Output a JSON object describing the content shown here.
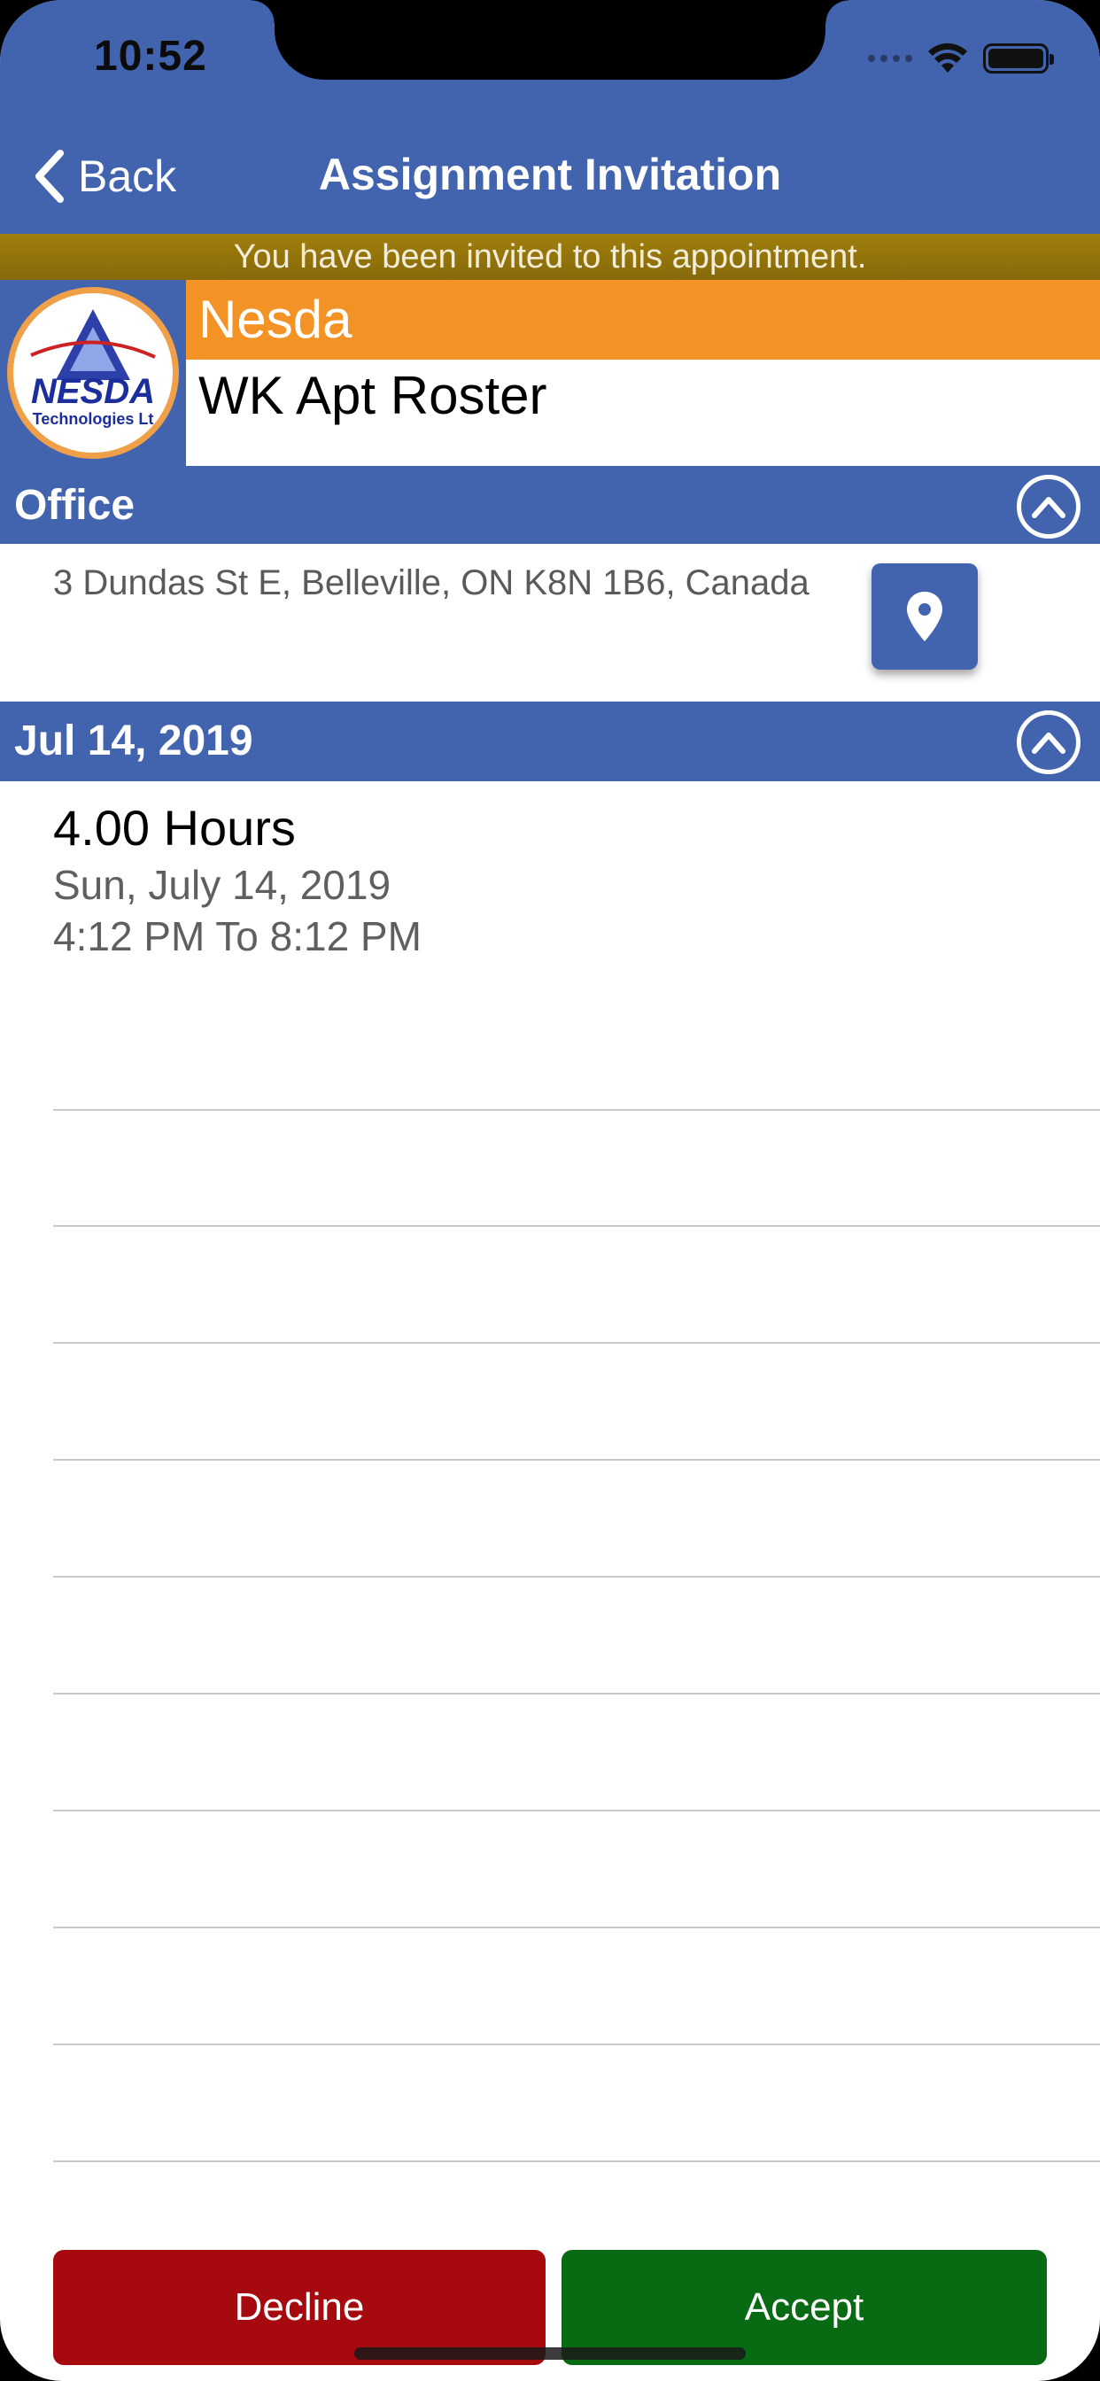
{
  "status_bar": {
    "time": "10:52"
  },
  "nav": {
    "back_label": "Back",
    "title": "Assignment Invitation"
  },
  "banner": {
    "text": "You have been invited to this appointment."
  },
  "client": {
    "name": "Nesda",
    "subtitle": "WK Apt Roster",
    "logo_text": "NESDA",
    "logo_subtext": "Technologies Lt"
  },
  "location_section": {
    "title": "Office",
    "address": "3 Dundas St E, Belleville, ON K8N 1B6, Canada"
  },
  "date_section": {
    "title": "Jul 14, 2019"
  },
  "shift": {
    "hours": "4.00 Hours",
    "date": "Sun, July 14, 2019",
    "time": "4:12 PM To 8:12 PM"
  },
  "actions": {
    "decline_label": "Decline",
    "accept_label": "Accept"
  },
  "colors": {
    "nav_blue": "#4263ad",
    "banner_gold": "#a07f0c",
    "client_orange": "#f39225",
    "decline_red": "#a60a0f",
    "accept_green": "#086a13"
  },
  "icons": [
    "wifi-icon",
    "battery-icon",
    "back-chevron-icon",
    "collapse-chevron-icon",
    "map-pin-icon"
  ]
}
